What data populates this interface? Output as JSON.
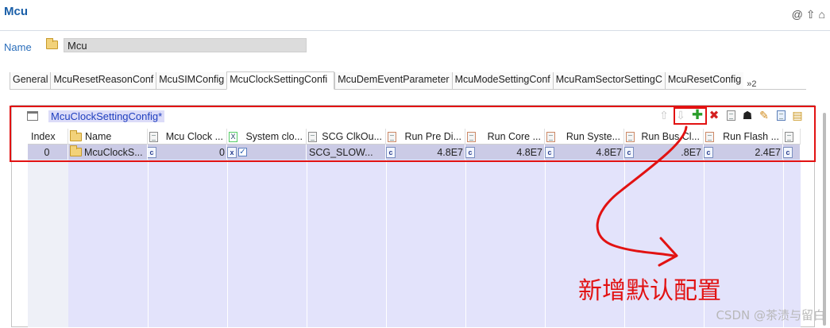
{
  "editor": {
    "title": "Mcu"
  },
  "name_row": {
    "label": "Name",
    "value": "Mcu"
  },
  "tabs": [
    {
      "label": "General"
    },
    {
      "label": "McuResetReasonConf"
    },
    {
      "label": "McuSIMConfig"
    },
    {
      "label": "McuClockSettingConfi",
      "active": true
    },
    {
      "label": "McuDemEventParameter"
    },
    {
      "label": "McuModeSettingConf"
    },
    {
      "label": "McuRamSectorSettingC"
    },
    {
      "label": "McuResetConfig"
    }
  ],
  "tabs_more": {
    "symbol": "»",
    "count": "2"
  },
  "panel": {
    "title": "McuClockSettingConfig*"
  },
  "toolbar": {
    "items": [
      "arrow-up-icon",
      "arrow-down-icon",
      "add-icon",
      "delete-icon",
      "copy-icon",
      "user-icon",
      "edit-icon",
      "table-edit-icon",
      "table-insert-icon"
    ]
  },
  "table": {
    "columns": [
      "Index",
      "Name",
      "Mcu Clock ...",
      "System clo...",
      "SCG ClkOu...",
      "Run Pre Di...",
      "Run Core ...",
      "Run Syste...",
      "Run Bus Cl...",
      "Run Flash ..."
    ],
    "rows": [
      {
        "index": "0",
        "name": "McuClockS...",
        "mcu_clock": "0",
        "system_clock": "checked",
        "scg_clkout": "SCG_SLOW...",
        "run_pre_div": "4.8E7",
        "run_core": "4.8E7",
        "run_system": "4.8E7",
        "run_bus": ".8E7",
        "run_flash": "2.4E7"
      }
    ]
  },
  "annotation": {
    "text": "新增默认配置",
    "color": "#e21212"
  },
  "watermark": "CSDN @茶渍与留白"
}
